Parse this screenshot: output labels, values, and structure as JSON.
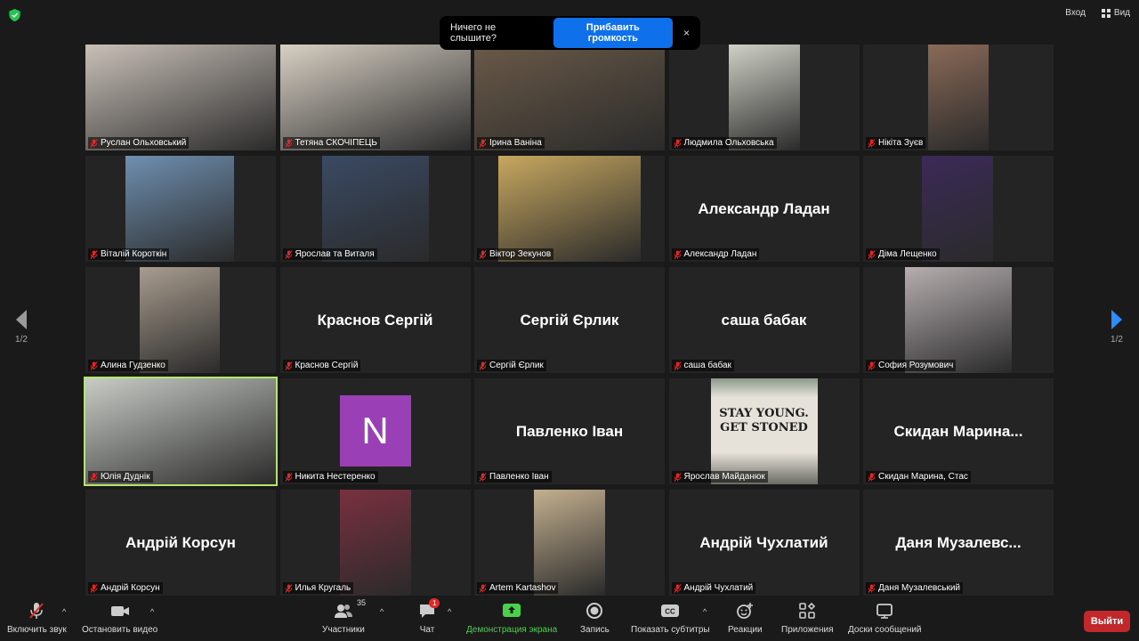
{
  "topbar": {
    "signin": "Вход",
    "view": "Вид"
  },
  "notice": {
    "text": "Ничего не слышите?",
    "button": "Прибавить громкость",
    "close": "×"
  },
  "pager": {
    "left": "1/2",
    "right": "1/2"
  },
  "participants": [
    {
      "name": "Руслан Ольховський"
    },
    {
      "name": "Тетяна СКОЧІПЕЦЬ"
    },
    {
      "name": "Ірина Ваніна"
    },
    {
      "name": "Людмила Ольховська"
    },
    {
      "name": "Нікіта Зуєв"
    },
    {
      "name": "Віталій Короткін"
    },
    {
      "name": "Ярослав та Виталя"
    },
    {
      "name": "Віктор Зекунов"
    },
    {
      "name": "Александр Ладан",
      "display": "Александр Ладан"
    },
    {
      "name": "Діма Лещенко"
    },
    {
      "name": "Алина Гудзенко"
    },
    {
      "name": "Краснов Сергій",
      "display": "Краснов Сергій"
    },
    {
      "name": "Сергій Єрлик",
      "display": "Сергій Єрлик"
    },
    {
      "name": "саша бабак",
      "display": "саша бабак"
    },
    {
      "name": "София Розумович"
    },
    {
      "name": "Юлія Дуднік"
    },
    {
      "name": "Никита Нестеренко",
      "avatar_letter": "N"
    },
    {
      "name": "Павленко Іван",
      "display": "Павленко Іван"
    },
    {
      "name": "Ярослав Майданюк",
      "sign_text": "STAY YOUNG. GET STONED"
    },
    {
      "name": "Скидан Марина, Стас",
      "display": "Скидан Марина..."
    },
    {
      "name": "Андрій Корсун",
      "display": "Андрій Корсун"
    },
    {
      "name": "Илья Кругаль"
    },
    {
      "name": "Artem Kartashov"
    },
    {
      "name": "Андрій Чухлатий",
      "display": "Андрій Чухлатий"
    },
    {
      "name": "Даня Музалевський",
      "display": "Даня Музалевс..."
    }
  ],
  "toolbar": {
    "unmute": "Включить звук",
    "stop_video": "Остановить видео",
    "participants": "Участники",
    "participants_count": "35",
    "chat": "Чат",
    "chat_badge": "1",
    "share": "Демонстрация экрана",
    "record": "Запись",
    "subtitles": "Показать субтитры",
    "reactions": "Реакции",
    "apps": "Приложения",
    "whiteboards": "Доски сообщений",
    "leave": "Выйти"
  },
  "colors": {
    "accent_blue": "#0e71eb",
    "share_green": "#4ad14a",
    "leave_red": "#c1282c",
    "active_speaker": "#b5e56a",
    "mic_muted": "#e02828"
  }
}
